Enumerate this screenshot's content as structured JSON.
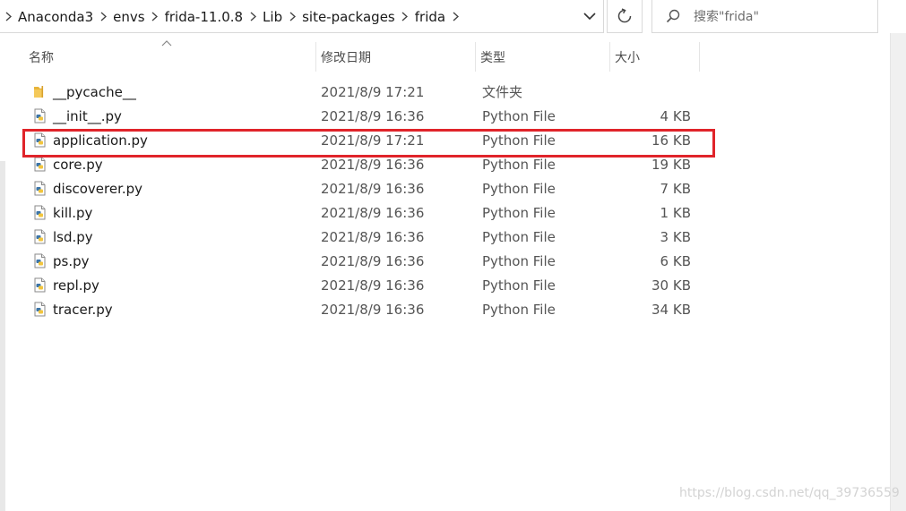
{
  "breadcrumb": {
    "items": [
      "Anaconda3",
      "envs",
      "frida-11.0.8",
      "Lib",
      "site-packages",
      "frida"
    ]
  },
  "search": {
    "placeholder": "搜索\"frida\""
  },
  "columns": {
    "name": "名称",
    "date": "修改日期",
    "type": "类型",
    "size": "大小"
  },
  "files": [
    {
      "name": "__pycache__",
      "date": "2021/8/9 17:21",
      "type": "文件夹",
      "size": "",
      "icon": "folder-icon"
    },
    {
      "name": "__init__.py",
      "date": "2021/8/9 16:36",
      "type": "Python File",
      "size": "4 KB",
      "icon": "python-file-icon"
    },
    {
      "name": "application.py",
      "date": "2021/8/9 17:21",
      "type": "Python File",
      "size": "16 KB",
      "icon": "python-file-icon"
    },
    {
      "name": "core.py",
      "date": "2021/8/9 16:36",
      "type": "Python File",
      "size": "19 KB",
      "icon": "python-file-icon"
    },
    {
      "name": "discoverer.py",
      "date": "2021/8/9 16:36",
      "type": "Python File",
      "size": "7 KB",
      "icon": "python-file-icon"
    },
    {
      "name": "kill.py",
      "date": "2021/8/9 16:36",
      "type": "Python File",
      "size": "1 KB",
      "icon": "python-file-icon"
    },
    {
      "name": "lsd.py",
      "date": "2021/8/9 16:36",
      "type": "Python File",
      "size": "3 KB",
      "icon": "python-file-icon"
    },
    {
      "name": "ps.py",
      "date": "2021/8/9 16:36",
      "type": "Python File",
      "size": "6 KB",
      "icon": "python-file-icon"
    },
    {
      "name": "repl.py",
      "date": "2021/8/9 16:36",
      "type": "Python File",
      "size": "30 KB",
      "icon": "python-file-icon"
    },
    {
      "name": "tracer.py",
      "date": "2021/8/9 16:36",
      "type": "Python File",
      "size": "34 KB",
      "icon": "python-file-icon"
    }
  ],
  "watermark": "https://blog.csdn.net/qq_39736559",
  "colors": {
    "highlight": "#e0242a",
    "folder": "#e8b43a",
    "python_blue": "#3b74a8",
    "python_yellow": "#f2c53d"
  }
}
